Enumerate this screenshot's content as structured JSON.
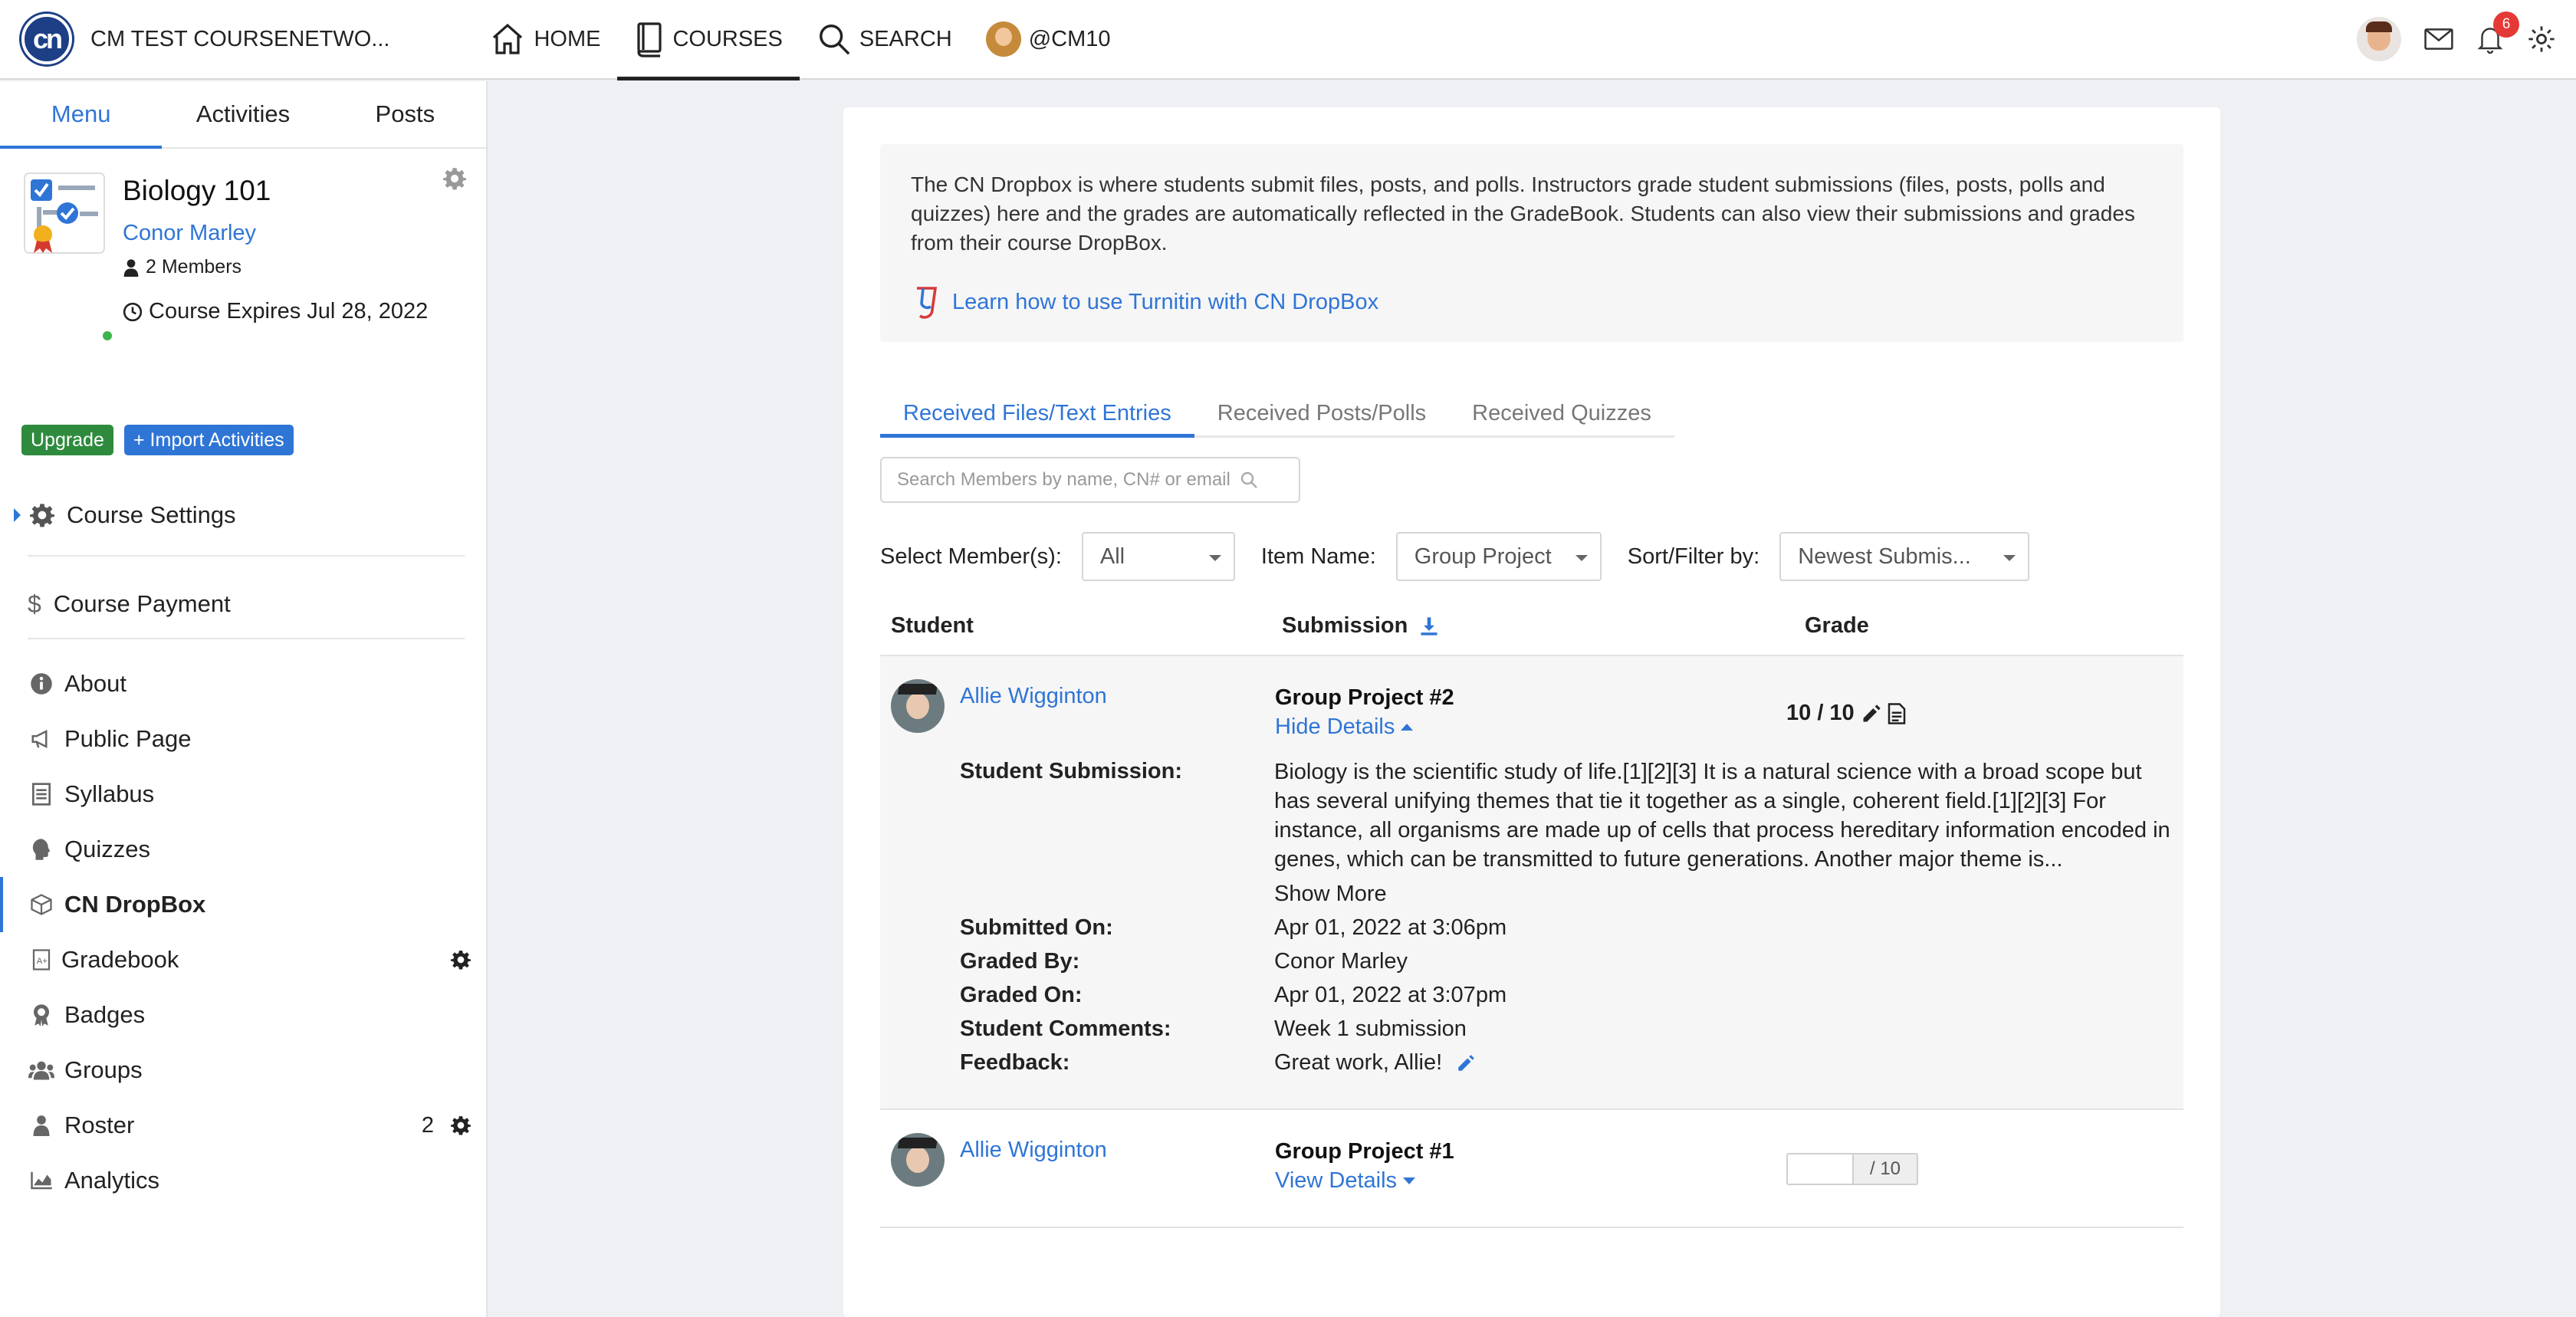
{
  "topbar": {
    "logo_text": "cn",
    "school_name": "CM TEST COURSENETWO...",
    "nav": [
      {
        "label": "HOME",
        "icon": "home-icon"
      },
      {
        "label": "COURSES",
        "icon": "book-icon"
      },
      {
        "label": "SEARCH",
        "icon": "search-icon"
      },
      {
        "label": "@CM10",
        "icon": "avatar"
      }
    ],
    "notification_count": "6"
  },
  "sidebar": {
    "tabs": [
      "Menu",
      "Activities",
      "Posts"
    ],
    "course": {
      "title": "Biology 101",
      "owner": "Conor Marley",
      "members": "2 Members",
      "expires": "Course Expires Jul 28, 2022"
    },
    "upgrade_label": "Upgrade",
    "import_label": "+ Import Activities",
    "course_settings": "Course Settings",
    "course_payment": "Course Payment",
    "items": [
      {
        "label": "About",
        "icon": "info-icon"
      },
      {
        "label": "Public Page",
        "icon": "megaphone-icon"
      },
      {
        "label": "Syllabus",
        "icon": "document-icon"
      },
      {
        "label": "Quizzes",
        "icon": "head-icon"
      },
      {
        "label": "CN DropBox",
        "icon": "cube-icon"
      },
      {
        "label": "Gradebook",
        "icon": "gradebook-icon"
      },
      {
        "label": "Badges",
        "icon": "badge-icon"
      },
      {
        "label": "Groups",
        "icon": "users-icon"
      },
      {
        "label": "Roster",
        "icon": "user-icon",
        "count": "2"
      },
      {
        "label": "Analytics",
        "icon": "chart-icon"
      }
    ]
  },
  "main": {
    "intro": "The CN Dropbox is where students submit files, posts, and polls. Instructors grade student submissions (files, posts, polls and quizzes) here and the grades are automatically reflected in the GradeBook. Students can also view their submissions and grades from their course DropBox.",
    "turnitin_link": "Learn how to use Turnitin with CN DropBox",
    "tabs": [
      "Received Files/Text Entries",
      "Received Posts/Polls",
      "Received Quizzes"
    ],
    "search_placeholder": "Search Members by name, CN# or email",
    "filters": {
      "member_label": "Select Member(s):",
      "member_value": "All",
      "item_label": "Item Name:",
      "item_value": "Group Project",
      "sort_label": "Sort/Filter by:",
      "sort_value": "Newest Submis..."
    },
    "columns": {
      "student": "Student",
      "submission": "Submission",
      "grade": "Grade"
    },
    "rows": [
      {
        "student": "Allie Wigginton",
        "title": "Group Project #2",
        "toggle": "Hide Details",
        "grade": "10 / 10",
        "details": {
          "submission_label": "Student Submission:",
          "submission_text": "Biology is the scientific study of life.[1][2][3] It is a natural science with a broad scope but has several unifying themes that tie it together as a single, coherent field.[1][2][3] For instance, all organisms are made up of cells that process hereditary information encoded in genes, which can be transmitted to future generations. Another major theme is...",
          "show_more": "Show More",
          "submitted_on_label": "Submitted On:",
          "submitted_on": "Apr 01, 2022 at 3:06pm",
          "graded_by_label": "Graded By:",
          "graded_by": "Conor Marley",
          "graded_on_label": "Graded On:",
          "graded_on": "Apr 01, 2022 at 3:07pm",
          "comments_label": "Student Comments:",
          "comments": "Week 1 submission",
          "feedback_label": "Feedback:",
          "feedback": "Great work, Allie!"
        }
      },
      {
        "student": "Allie Wigginton",
        "title": "Group Project #1",
        "toggle": "View Details",
        "grade_max": "/ 10"
      }
    ]
  }
}
